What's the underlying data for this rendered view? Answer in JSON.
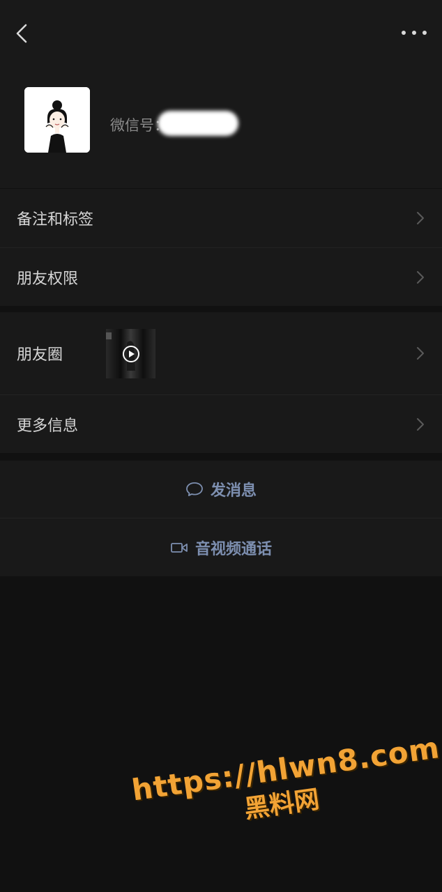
{
  "header": {
    "back_icon": "chevron-left-icon",
    "more_icon": "more-dots-icon"
  },
  "profile": {
    "wechat_id_label": "微信号："
  },
  "menu_group_1": [
    {
      "label": "备注和标签"
    },
    {
      "label": "朋友权限"
    }
  ],
  "menu_group_2": [
    {
      "label": "朋友圈"
    },
    {
      "label": "更多信息"
    }
  ],
  "actions": {
    "send_message": "发消息",
    "video_call": "音视频通话"
  },
  "watermark": {
    "url": "https://hlwn8.com",
    "name": "黑料网"
  },
  "colors": {
    "background": "#111111",
    "panel": "#191919",
    "action_text": "#7d8fb0",
    "watermark": "#f2a335"
  }
}
